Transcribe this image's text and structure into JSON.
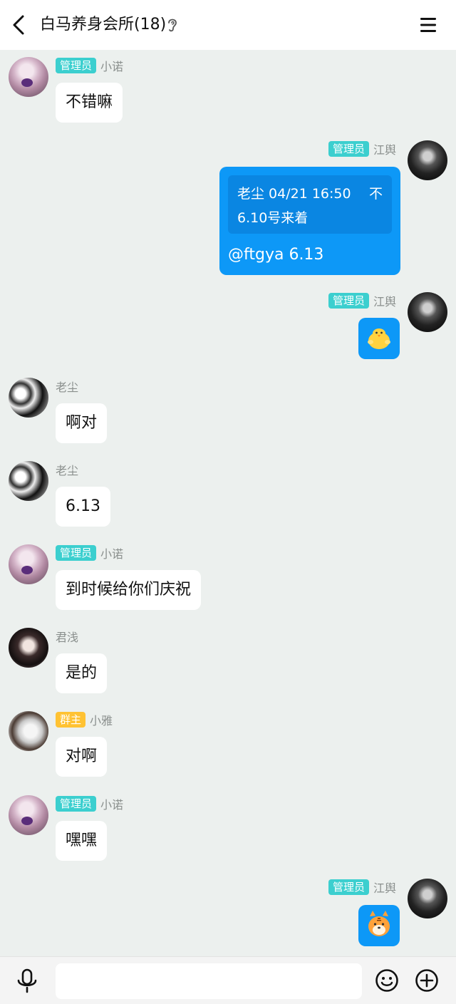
{
  "header": {
    "title": "白马养身会所(18)"
  },
  "badges": {
    "admin": "管理员",
    "owner": "群主"
  },
  "messages": [
    {
      "sender": "小诺",
      "role": "admin",
      "text": "不错嘛"
    },
    {
      "sender": "江舆",
      "role": "admin",
      "quote": {
        "author_time": "老尘 04/21 16:50",
        "right": "不",
        "text": "6.10号来着"
      },
      "text": "@ftgya 6.13"
    },
    {
      "sender": "江舆",
      "role": "admin",
      "sticker": "chick-sticker"
    },
    {
      "sender": "老尘",
      "text": "啊对"
    },
    {
      "sender": "老尘",
      "text": "6.13"
    },
    {
      "sender": "小诺",
      "role": "admin",
      "text": "到时候给你们庆祝"
    },
    {
      "sender": "君浅",
      "text": "是的"
    },
    {
      "sender": "小雅",
      "role": "owner",
      "text": "对啊"
    },
    {
      "sender": "小诺",
      "role": "admin",
      "text": "嘿嘿"
    },
    {
      "sender": "江舆",
      "role": "admin",
      "sticker": "tiger-sticker"
    }
  ],
  "composer": {
    "value": "",
    "placeholder": ""
  },
  "colors": {
    "accent": "#0d98f7",
    "admin_badge": "#3ccfcf",
    "owner_badge": "#ffc233",
    "chat_bg": "#ecf0ee"
  }
}
